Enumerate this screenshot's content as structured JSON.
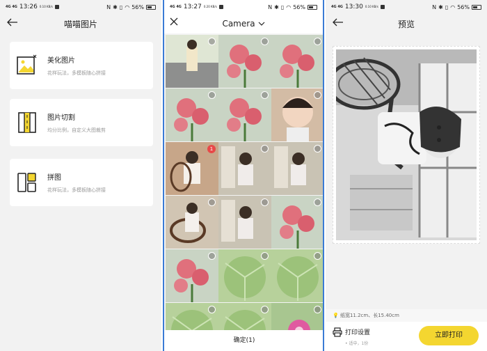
{
  "status": [
    {
      "signal": "4G 4G",
      "time": "13:26",
      "speed": "0.10 KB/s",
      "battery": "56%"
    },
    {
      "signal": "4G 4G",
      "time": "13:27",
      "speed": "0.20 KB/s",
      "battery": "56%"
    },
    {
      "signal": "4G 4G",
      "time": "13:30",
      "speed": "0.10 KB/s",
      "battery": "56%"
    }
  ],
  "screen1": {
    "title": "喵喵图片",
    "cards": [
      {
        "title": "美化图片",
        "subtitle": "花样玩法，多模板随心拼接",
        "icon": "image-edit-icon"
      },
      {
        "title": "图片切割",
        "subtitle": "均分比例，自定义大图裁剪",
        "icon": "cut-strip-icon"
      },
      {
        "title": "拼图",
        "subtitle": "花样玩法，多模板随心拼接",
        "icon": "collage-icon"
      }
    ]
  },
  "screen2": {
    "album": "Camera",
    "confirm_label": "确定(1)",
    "selected_badge": "1",
    "photos": [
      "girl-road",
      "flowers",
      "flowers",
      "flowers",
      "flowers",
      "girl-face",
      "girl-selected",
      "girl",
      "girl",
      "girl-chair",
      "girl",
      "flowers",
      "flowers",
      "leaf",
      "leaf",
      "leaf",
      "leaf",
      "pink-flower"
    ]
  },
  "screen3": {
    "title": "预览",
    "size_text": "纸宽11.2cm、长15.40cm",
    "print_settings": "打印设置",
    "print_settings_sub": "• 适中，1份",
    "print_button": "立即打印"
  },
  "colors": {
    "accent_yellow": "#f4d630",
    "badge_red": "#e84848",
    "divider_blue": "#3a7bd5"
  }
}
